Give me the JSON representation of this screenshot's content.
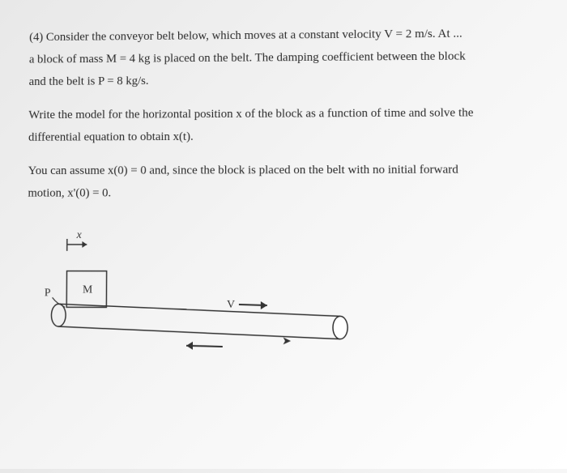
{
  "question": {
    "number": "(4)",
    "para1": "Consider the conveyor belt below, which moves at a constant velocity V = 2 m/s. At ...",
    "para2": "a block of mass M = 4 kg is placed on the belt. The damping coefficient between the block",
    "para3": "and the belt is P = 8 kg/s.",
    "para4": "Write the model for the horizontal position x of the block as a function of time and solve the",
    "para5": "differential equation to obtain x(t).",
    "para6": "You can assume x(0) = 0 and, since the block is placed on the belt with no initial forward",
    "para7": "motion, x'(0) = 0."
  },
  "diagram": {
    "x_label": "x",
    "mass_label": "M",
    "damping_label": "P",
    "velocity_label": "V"
  }
}
